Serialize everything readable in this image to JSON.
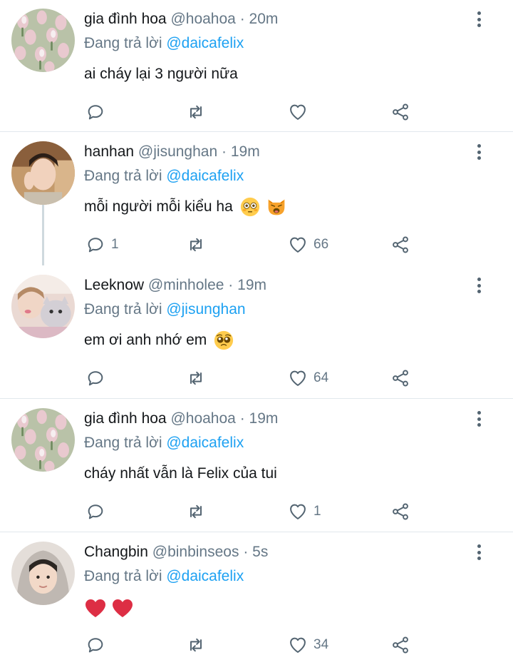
{
  "reply_prefix": "Đang trả lời",
  "colors": {
    "accent": "#1da1f2",
    "muted": "#657786",
    "text": "#14171a",
    "divider": "#e1e8ed",
    "heart": "#e0245e"
  },
  "tweets": [
    {
      "name": "gia đình hoa",
      "handle": "@hoahoa",
      "dot": "·",
      "time": "20m",
      "reply_to": "@daicafelix",
      "text": "ai cháy lại 3 người nữa",
      "emojis": [],
      "reply_count": "",
      "retweet_count": "",
      "like_count": "",
      "avatar": "tulip-field"
    },
    {
      "name": "hanhan",
      "handle": "@jisunghan",
      "dot": "·",
      "time": "19m",
      "reply_to": "@daicafelix",
      "text": "mỗi người mỗi kiểu ha",
      "emojis": [
        "flushed-face-emoji",
        "weary-cat-emoji"
      ],
      "reply_count": "1",
      "retweet_count": "",
      "like_count": "66",
      "avatar": "boy-selfie"
    },
    {
      "name": "Leeknow",
      "handle": "@minholee",
      "dot": "·",
      "time": "19m",
      "reply_to": "@jisunghan",
      "text": "em ơi anh nhớ em",
      "emojis": [
        "pleading-face-emoji"
      ],
      "reply_count": "",
      "retweet_count": "",
      "like_count": "64",
      "avatar": "cat-photo"
    },
    {
      "name": "gia đình hoa",
      "handle": "@hoahoa",
      "dot": "·",
      "time": "19m",
      "reply_to": "@daicafelix",
      "text": "cháy nhất vẫn là Felix của tui",
      "emojis": [],
      "reply_count": "",
      "retweet_count": "",
      "like_count": "1",
      "avatar": "tulip-field"
    },
    {
      "name": "Changbin",
      "handle": "@binbinseos",
      "dot": "·",
      "time": "5s",
      "reply_to": "@daicafelix",
      "text": "",
      "emojis": [
        "red-heart-emoji",
        "red-heart-emoji"
      ],
      "reply_count": "",
      "retweet_count": "",
      "like_count": "34",
      "avatar": "hoodie-boy"
    }
  ]
}
